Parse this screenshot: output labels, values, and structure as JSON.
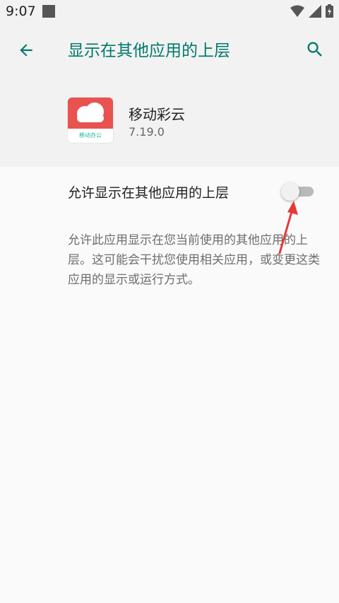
{
  "status_bar": {
    "time": "9:07",
    "icons": [
      "notification-square-icon",
      "wifi-icon",
      "signal-icon",
      "battery-icon"
    ]
  },
  "toolbar": {
    "title": "显示在其他应用的上层",
    "back_icon": "arrow-left-icon",
    "search_icon": "search-icon",
    "accent_color": "#00796b"
  },
  "app": {
    "name": "移动彩云",
    "version": "7.19.0",
    "icon_caption": "移动办公",
    "icon_color": "#e8524f"
  },
  "setting": {
    "label": "允许显示在其他应用的上层",
    "enabled": false,
    "description": "允许此应用显示在您当前使用的其他应用的上层。这可能会干扰您使用相关应用，或变更这类应用的显示或运行方式。"
  },
  "annotation": {
    "arrow_color": "#e53935"
  }
}
